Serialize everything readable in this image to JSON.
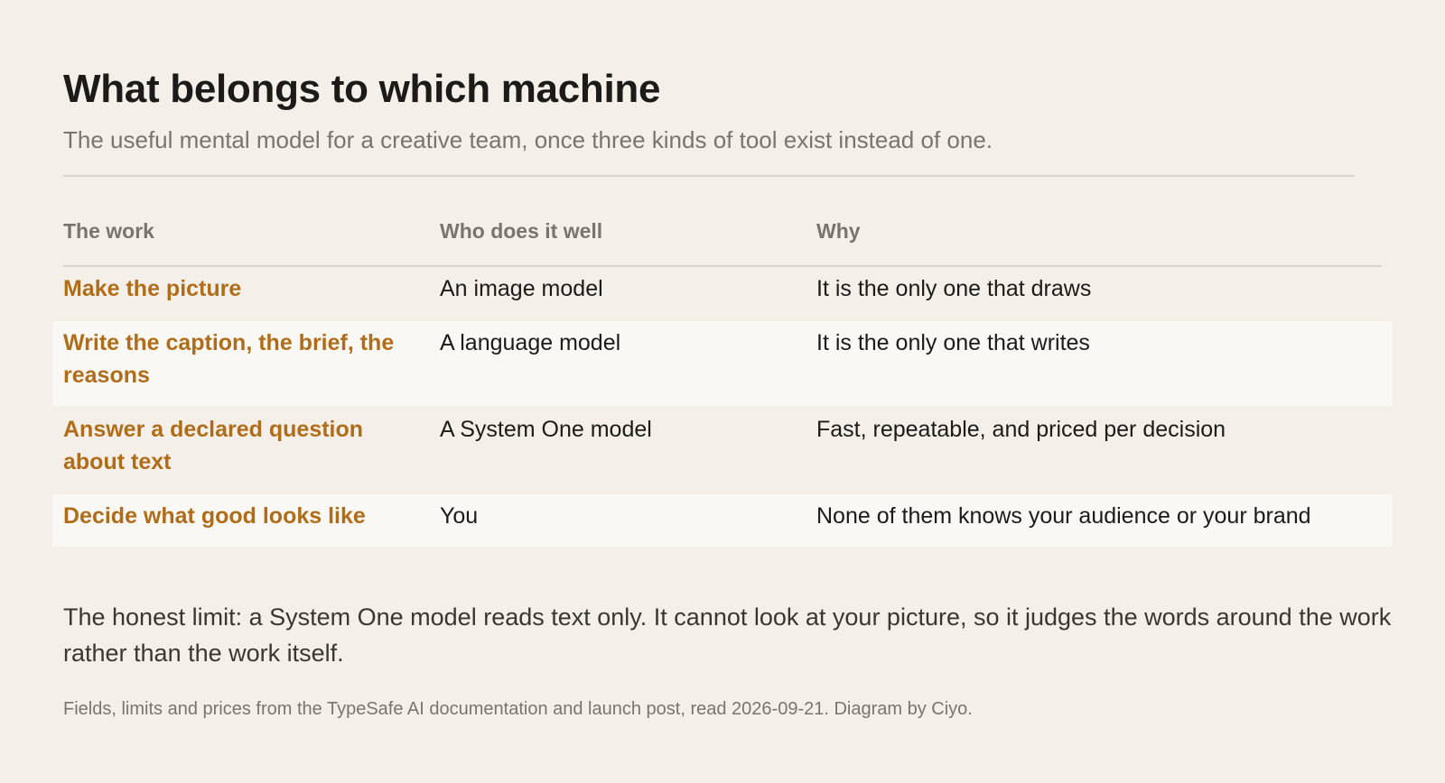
{
  "header": {
    "title": "What belongs to which machine",
    "subtitle": "The useful mental model for a creative team, once three kinds of tool exist instead of one."
  },
  "table": {
    "columns": [
      "The work",
      "Who does it well",
      "Why"
    ],
    "rows": [
      {
        "work": "Make the picture",
        "who": "An image model",
        "why": "It is the only one that draws"
      },
      {
        "work": "Write the caption, the brief, the reasons",
        "who": "A language model",
        "why": "It is the only one that writes"
      },
      {
        "work": "Answer a declared question about text",
        "who": "A System One model",
        "why": "Fast, repeatable, and priced per decision"
      },
      {
        "work": "Decide what good looks like",
        "who": "You",
        "why": "None of them knows your audience or your brand"
      }
    ]
  },
  "note": "The honest limit: a System One model reads text only. It cannot look at your picture, so it judges the words around the work rather than the work itself.",
  "footnote": "Fields, limits and prices from the TypeSafe AI documentation and launch post, read 2026-09-21. Diagram by Ciyo.",
  "colors": {
    "background": "#f4f0e9",
    "accent": "#b06d19",
    "row_alt": "#f9f8f5",
    "muted": "#7a746e"
  }
}
